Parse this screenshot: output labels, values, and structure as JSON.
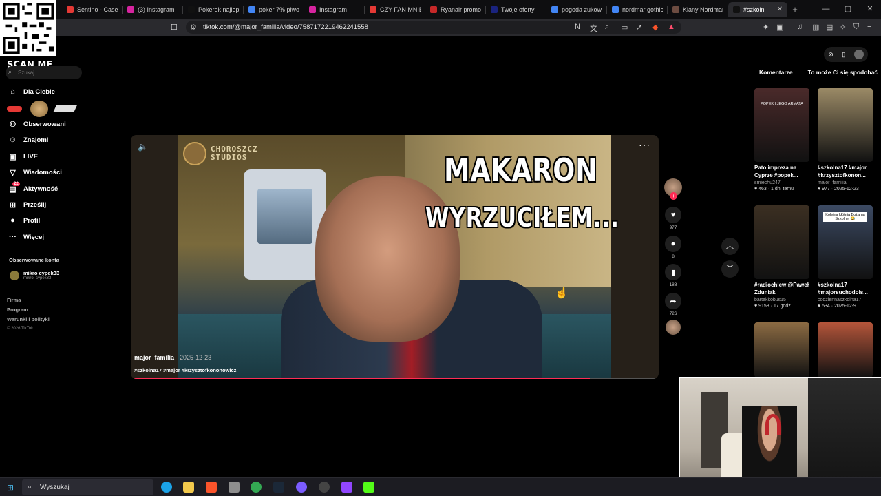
{
  "browser": {
    "tabs": [
      {
        "label": "Sentino - Case",
        "fav_color": "#e53935"
      },
      {
        "label": "(3) Instagram",
        "fav_color": "#d6249f"
      },
      {
        "label": "Pokerek najlep",
        "fav_color": "#111111"
      },
      {
        "label": "poker 7% piwo",
        "fav_color": "#4285f4"
      },
      {
        "label": "Instagram",
        "fav_color": "#d6249f"
      },
      {
        "label": "CZY FAN MNIE",
        "fav_color": "#e53935"
      },
      {
        "label": "Ryanair promoc",
        "fav_color": "#c62828"
      },
      {
        "label": "Twoje oferty",
        "fav_color": "#1a237e"
      },
      {
        "label": "pogoda zukowo",
        "fav_color": "#4285f4"
      },
      {
        "label": "nordmar gothic",
        "fav_color": "#4285f4"
      },
      {
        "label": "Klany Nordmar",
        "fav_color": "#6d4c41"
      },
      {
        "label": "#szkoln",
        "fav_color": "#111111"
      }
    ],
    "url": "tiktok.com/@major_familia/video/7587172219462241558",
    "new_tab": "+"
  },
  "overlay": {
    "scan_me": "SCAN ME"
  },
  "sidebar": {
    "search_placeholder": "Szukaj",
    "items": [
      {
        "label": "Dla Ciebie",
        "icon": "home-icon",
        "glyph": "⌂"
      },
      {
        "label": "Obserwowani",
        "icon": "following-icon",
        "glyph": "⚇"
      },
      {
        "label": "Znajomi",
        "icon": "friends-icon",
        "glyph": "☺"
      },
      {
        "label": "LIVE",
        "icon": "live-icon",
        "glyph": "▣"
      },
      {
        "label": "Wiadomości",
        "icon": "messages-icon",
        "glyph": "▽"
      },
      {
        "label": "Aktywność",
        "icon": "activity-icon",
        "glyph": "▤",
        "badge": "22"
      },
      {
        "label": "Prześlij",
        "icon": "upload-icon",
        "glyph": "⊞"
      },
      {
        "label": "Profil",
        "icon": "profile-icon",
        "glyph": "●"
      },
      {
        "label": "Więcej",
        "icon": "more-icon",
        "glyph": "···"
      }
    ],
    "followed_header": "Obserwowane konta",
    "followed": {
      "name": "mikro cypek33",
      "handle": "mikro_cypek33"
    },
    "footer": [
      "Firma",
      "Program",
      "Warunki i polityki"
    ],
    "copyright": "© 2026 TikTok"
  },
  "video": {
    "brand": "CHOROSZCZ\nSTUDIOS",
    "caption_line1": "MAKARON",
    "caption_line2": "WYRZUCIŁEM...",
    "author": "major_familia",
    "date": "· 2025-12-23",
    "hashtags": "#szkolna17 #major #krzysztofkononowicz",
    "progress": 0.87
  },
  "actions": {
    "likes": "977",
    "comments": "8",
    "saves": "188",
    "shares": "726"
  },
  "right_panel": {
    "tabs": [
      "Komentarze",
      "To może Ci się spodobać"
    ],
    "cards": [
      {
        "title": "Pato impreza na Cyprze #popek...",
        "user": "smiechu247",
        "meta": "♥ 463 · 1 dn. temu",
        "overlay_text": "POPEK I JEGO ARMATA",
        "color": "#4a2a2a"
      },
      {
        "title": "#szkolna17 #major #krzysztofkonon...",
        "user": "major_familia",
        "meta": "♥ 977 · 2025-12-23",
        "overlay_text": "",
        "color": "#9b8a66"
      },
      {
        "title": "#radiochlew @Paweł Zduniak",
        "user": "bartekkobus15",
        "meta": "♥ 9158 · 17 godz...",
        "overlay_text": "",
        "color": "#3b2f22"
      },
      {
        "title": "#szkolna17 #majorsuchodols...",
        "user": "codziennaszkolna17",
        "meta": "♥ 534 · 2025-12-9",
        "overlay_text": "Kolejna kłótnia Boża na Szkolnej 😂",
        "color": "#3c4a63"
      },
      {
        "title": "",
        "user": "",
        "meta": "",
        "overlay_text": "",
        "color": "#8c6b43"
      },
      {
        "title": "",
        "user": "",
        "meta": "",
        "overlay_text": "",
        "color": "#b4553a"
      }
    ]
  },
  "taskbar": {
    "search_placeholder": "Wyszukaj"
  }
}
